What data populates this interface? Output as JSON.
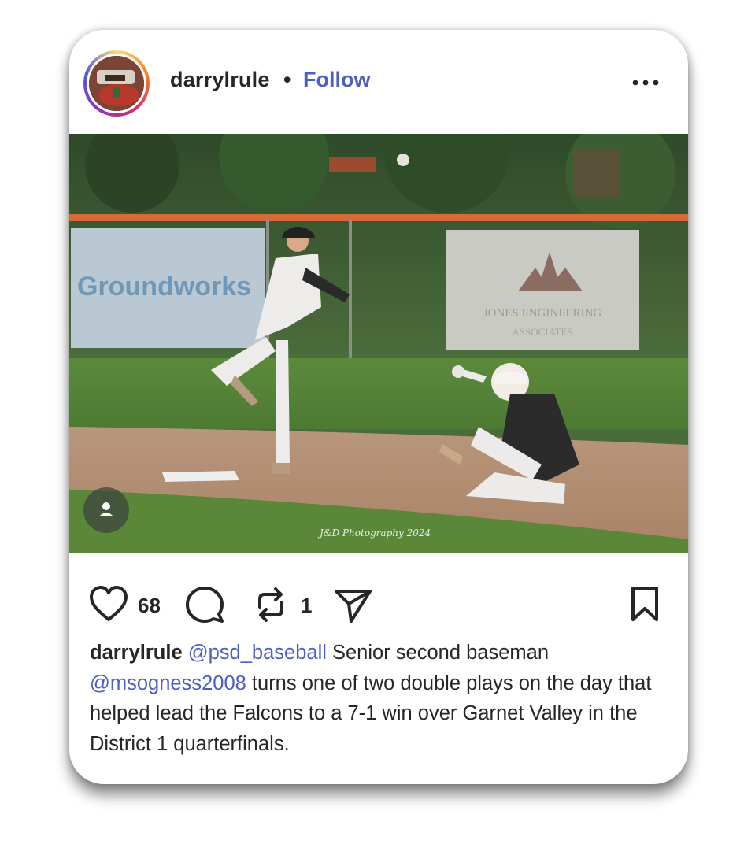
{
  "post": {
    "username": "darrylrule",
    "separator": "•",
    "follow_label": "Follow",
    "more_icon": "more-horizontal-icon",
    "photo": {
      "left_banner": "Groundworks",
      "right_banner_line1": "JONES ENGINEERING",
      "right_banner_line2": "ASSOCIATES",
      "watermark": "J&D Photography 2024"
    },
    "likes_count": "68",
    "reposts_count": "1",
    "caption": {
      "user": "darrylrule",
      "mention1": "@psd_baseball",
      "text1": " Senior second baseman ",
      "mention2": "@msogness2008",
      "text2": " turns one of two double plays on the day that helped lead the Falcons to a 7-1 win over Garnet Valley in the District 1 quarterfinals."
    }
  },
  "colors": {
    "link": "#4a5fc1",
    "text": "#262626"
  }
}
